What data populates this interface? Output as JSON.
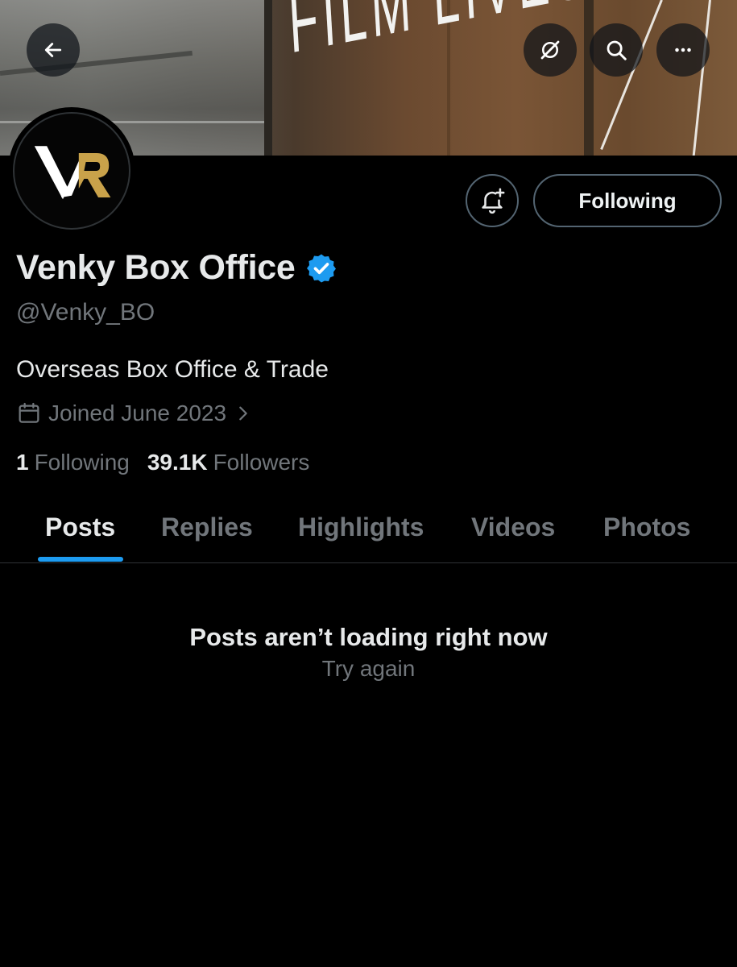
{
  "banner": {
    "lettering": "FILM LIVES HERE"
  },
  "header": {
    "back_icon": "arrow-left-icon",
    "grok_icon": "grok-icon",
    "search_icon": "search-icon",
    "more_icon": "more-horizontal-icon"
  },
  "profile": {
    "name": "Venky Box Office",
    "handle": "@Venky_BO",
    "bio": "Overseas Box Office & Trade",
    "joined": "Joined June 2023",
    "following_count": "1",
    "following_label": "Following",
    "followers_count": "39.1K",
    "followers_label": "Followers",
    "follow_button": "Following",
    "verified_color": "#1d9bf0"
  },
  "tabs": [
    {
      "label": "Posts",
      "active": true
    },
    {
      "label": "Replies",
      "active": false
    },
    {
      "label": "Highlights",
      "active": false
    },
    {
      "label": "Videos",
      "active": false
    },
    {
      "label": "Photos",
      "active": false
    }
  ],
  "feed": {
    "error_title": "Posts aren’t loading right now",
    "retry_label": "Try again"
  },
  "colors": {
    "accent": "#1d9bf0",
    "background": "#000000",
    "muted_text": "#71767b",
    "logo_gold": "#c9a24a"
  }
}
